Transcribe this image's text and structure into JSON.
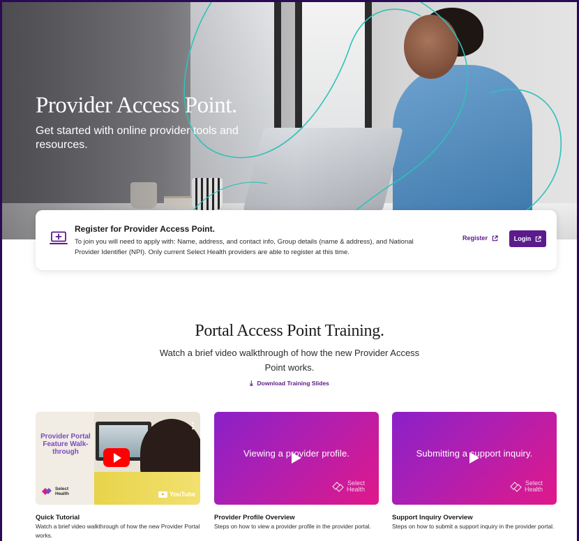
{
  "hero": {
    "title": "Provider Access Point.",
    "subtitle": "Get started with online provider tools and resources."
  },
  "register": {
    "title": "Register for Provider Access Point.",
    "description": "To join you will need to apply with: Name, address, and contact info, Group details (name & address), and National Provider Identifier (NPI). Only current Select Health providers are able to register at this time.",
    "register_label": "Register",
    "login_label": "Login"
  },
  "training": {
    "title": "Portal Access Point Training.",
    "subtitle": "Watch a brief video walkthrough of how the new Provider Access Point works.",
    "download_label": "Download Training Slides"
  },
  "videos": [
    {
      "thumb_title": "Provider Portal Feature Walk-through",
      "logo_line1": "Select",
      "logo_line2": "Health",
      "platform": "YouTube",
      "title": "Quick Tutorial",
      "description": "Watch a brief video walkthrough of how the new Provider Portal works."
    },
    {
      "thumb_text": "Viewing a provider profile.",
      "logo_line1": "Select",
      "logo_line2": "Health",
      "title": "Provider Profile Overview",
      "description": "Steps on how to view a provider profile in the provider portal."
    },
    {
      "thumb_text": "Submitting a support inquiry.",
      "logo_line1": "Select",
      "logo_line2": "Health",
      "title": "Support Inquiry Overview",
      "description": "Steps on how to submit a support inquiry in the provider portal."
    }
  ],
  "colors": {
    "brand_purple": "#5b1b8c",
    "link_purple": "#5d1a8a",
    "accent_teal": "#2fc1b8",
    "gradient_start": "#8a20c8",
    "gradient_end": "#e0188a"
  },
  "icons": [
    "laptop-plus-icon",
    "external-link-icon",
    "download-icon",
    "play-icon",
    "youtube-icon",
    "select-health-logo"
  ]
}
